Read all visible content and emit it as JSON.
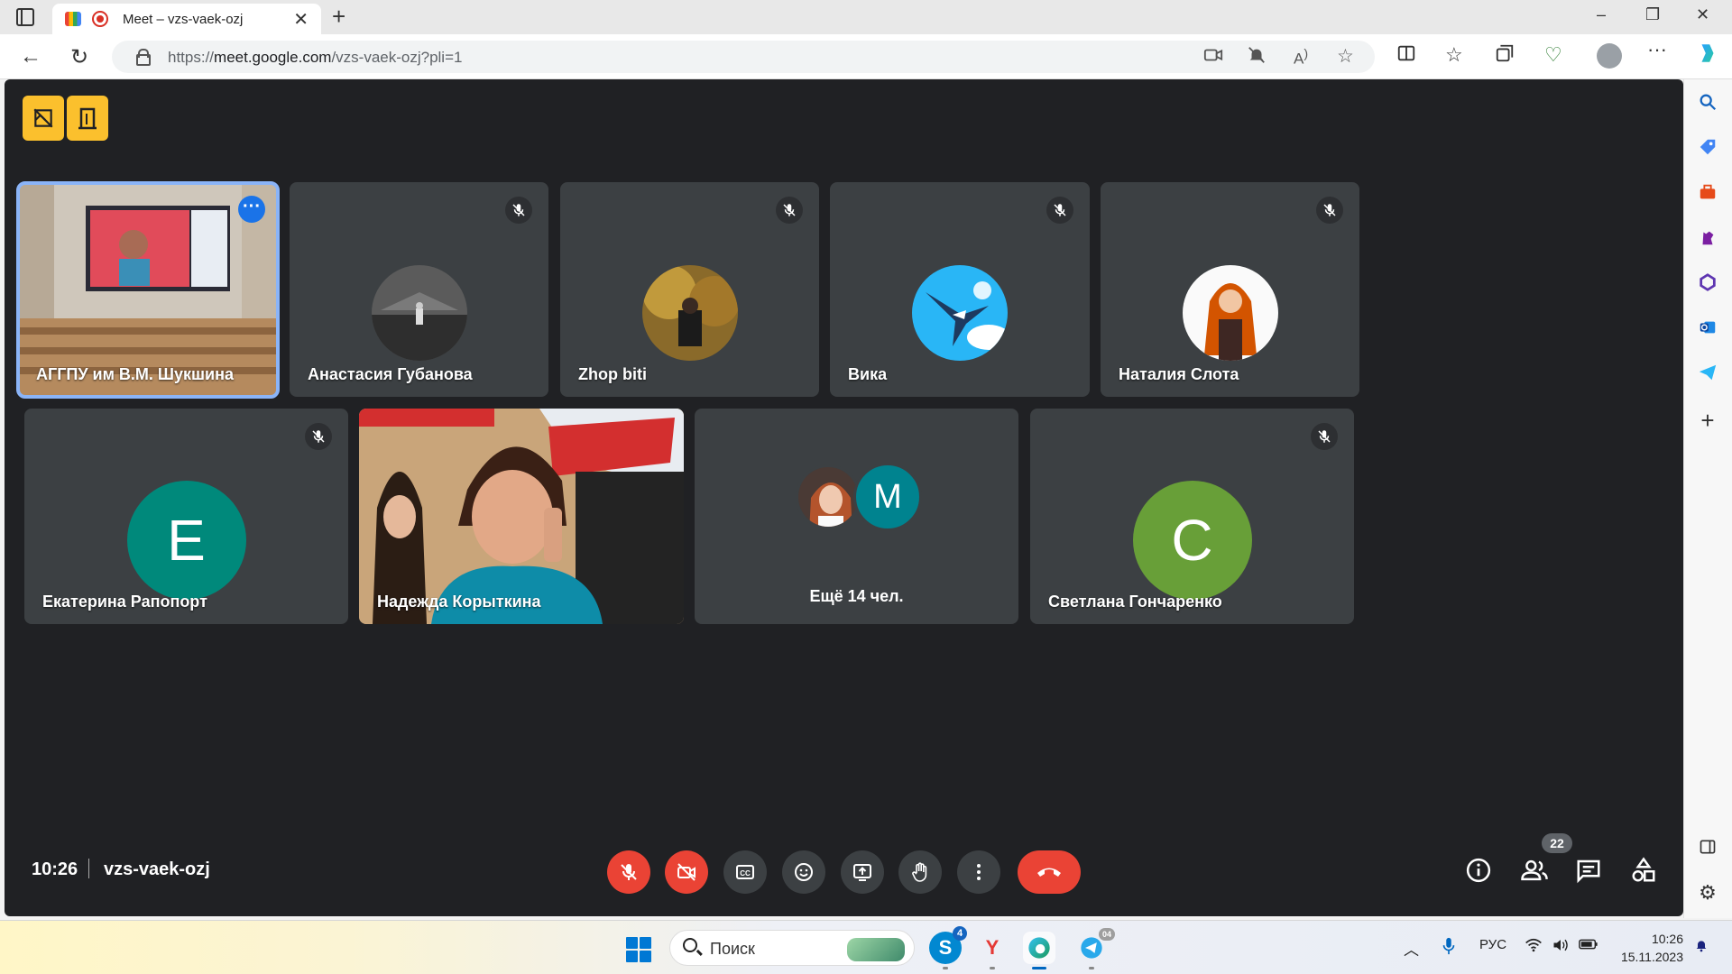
{
  "browser": {
    "tab_title": "Meet – vzs-vaek-ozj",
    "tab_close": "✕",
    "new_tab": "+",
    "url_scheme": "https://",
    "url_host": "meet.google.com",
    "url_path": "/vzs-vaek-ozj?pli=1",
    "window_controls": [
      "–",
      "❐",
      "✕"
    ],
    "nav": {
      "back": "←",
      "reload": "↻"
    },
    "toolbar_icons": [
      "camera-icon",
      "notifications-off-icon",
      "read-aloud-icon",
      "favorite-star-icon",
      "split-screen-icon",
      "favorites-icon",
      "collections-icon",
      "browser-essentials-icon",
      "profile-avatar",
      "settings-more-icon",
      "copilot-icon"
    ]
  },
  "sidebar": {
    "items": [
      "search-icon",
      "shopping-tag-icon",
      "tools-briefcase-icon",
      "games-icon",
      "microsoft365-icon",
      "outlook-icon",
      "telegram-send-icon",
      "add-icon"
    ],
    "bottom": [
      "hide-sidebar-icon",
      "settings-gear-icon"
    ]
  },
  "meet": {
    "participants_row1": [
      {
        "name": "АГГПУ им В.М. Шукшина",
        "kind": "video",
        "active": true
      },
      {
        "name": "Анастасия Губанова",
        "kind": "photo",
        "muted": true
      },
      {
        "name": "Zhop biti",
        "kind": "photo",
        "muted": true
      },
      {
        "name": "Вика",
        "kind": "photo",
        "muted": true
      },
      {
        "name": "Наталия Слота",
        "kind": "photo",
        "muted": true
      }
    ],
    "participants_row2": [
      {
        "name": "Екатерина Рапопорт",
        "letter": "Е",
        "color": "#00897b",
        "muted": true
      },
      {
        "name": "Надежда Корыткина",
        "kind": "video",
        "muted": true
      },
      {
        "more_label": "Ещё 14 чел.",
        "letter": "M",
        "color": "#00838f"
      },
      {
        "name": "Светлана Гончаренко",
        "letter": "С",
        "color": "#689f38",
        "muted": true
      }
    ],
    "time": "10:26",
    "meeting_code": "vzs-vaek-ozj",
    "participant_count": "22",
    "controls": [
      "mic-off",
      "camera-off",
      "captions",
      "emoji",
      "present-screen",
      "raise-hand",
      "more-options",
      "leave-call"
    ],
    "right_controls": [
      "meeting-info",
      "people",
      "chat",
      "activities"
    ],
    "accent": "#8ab4f8",
    "danger": "#ea4335",
    "top_buttons": [
      "visual-effects-icon",
      "breakout-rooms-icon"
    ],
    "top_button_color": "#fbc02d"
  },
  "taskbar": {
    "search_placeholder": "Поиск",
    "skype_badge": "4",
    "telegram_badge": "04",
    "language": "РУС",
    "clock_time": "10:26",
    "clock_date": "15.11.2023"
  }
}
